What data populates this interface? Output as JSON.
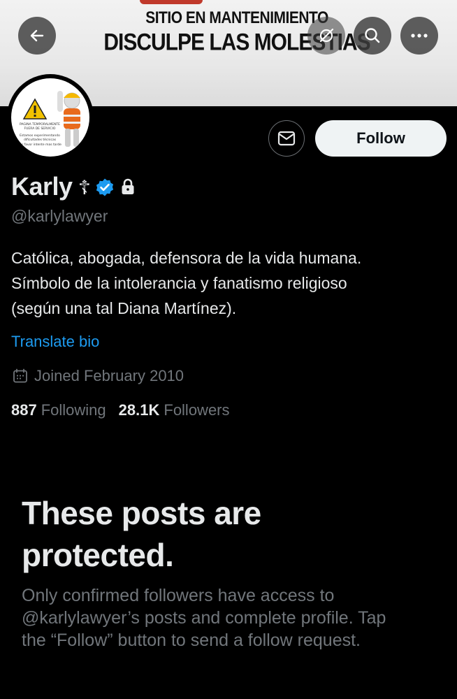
{
  "banner": {
    "line1": "SITIO EN MANTENIMIENTO",
    "line2": "DISCULPE LAS MOLESTIAS"
  },
  "topbar": {
    "back_icon": "arrow-left-icon",
    "grok_icon": "grok-icon",
    "search_icon": "search-icon",
    "more_icon": "more-icon"
  },
  "avatar": {
    "text1": "PAGINA TEMPORALMENTE FUERA DE SERVICIO",
    "text2": "Estamos experimentando dificultades técnicas",
    "text3": "Por favor intente mas tarde"
  },
  "actions": {
    "message_icon": "envelope-icon",
    "follow_label": "Follow"
  },
  "profile": {
    "name": "Karly",
    "name_symbol": "☦",
    "handle": "@karlylawyer",
    "bio_lines": [
      "Católica, abogada, defensora de la vida humana.",
      "Símbolo de la intolerancia y fanatismo religioso",
      "(según una tal Diana Martínez)."
    ],
    "translate_label": "Translate bio",
    "joined": "Joined February 2010",
    "following_count": "887",
    "following_label": "Following",
    "followers_count": "28.1K",
    "followers_label": "Followers"
  },
  "protected": {
    "title_line1": "These posts are",
    "title_line2": "protected.",
    "sub_line1": "Only confirmed followers have access to",
    "sub_line2": "@karlylawyer’s posts and complete profile. Tap",
    "sub_line3": "the “Follow” button to send a follow request."
  },
  "colors": {
    "background": "#000000",
    "accent": "#1d9bf0",
    "text_primary": "#e7e9ea",
    "text_secondary": "#71767b",
    "follow_button_bg": "#eff3f4"
  }
}
